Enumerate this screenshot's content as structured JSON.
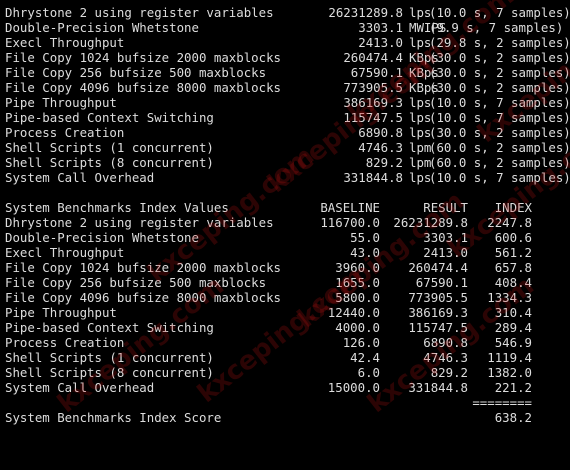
{
  "results": [
    {
      "name": "Dhrystone 2 using register variables",
      "value": "26231289.8",
      "unit": "lps",
      "note": "(10.0 s, 7 samples)"
    },
    {
      "name": "Double-Precision Whetstone",
      "value": "3303.1",
      "unit": "MWIPS",
      "note": "(9.9 s, 7 samples)"
    },
    {
      "name": "Execl Throughput",
      "value": "2413.0",
      "unit": "lps",
      "note": "(29.8 s, 2 samples)"
    },
    {
      "name": "File Copy 1024 bufsize 2000 maxblocks",
      "value": "260474.4",
      "unit": "KBps",
      "note": "(30.0 s, 2 samples)"
    },
    {
      "name": "File Copy 256 bufsize 500 maxblocks",
      "value": "67590.1",
      "unit": "KBps",
      "note": "(30.0 s, 2 samples)"
    },
    {
      "name": "File Copy 4096 bufsize 8000 maxblocks",
      "value": "773905.5",
      "unit": "KBps",
      "note": "(30.0 s, 2 samples)"
    },
    {
      "name": "Pipe Throughput",
      "value": "386169.3",
      "unit": "lps",
      "note": "(10.0 s, 7 samples)"
    },
    {
      "name": "Pipe-based Context Switching",
      "value": "115747.5",
      "unit": "lps",
      "note": "(10.0 s, 7 samples)"
    },
    {
      "name": "Process Creation",
      "value": "6890.8",
      "unit": "lps",
      "note": "(30.0 s, 2 samples)"
    },
    {
      "name": "Shell Scripts (1 concurrent)",
      "value": "4746.3",
      "unit": "lpm",
      "note": "(60.0 s, 2 samples)"
    },
    {
      "name": "Shell Scripts (8 concurrent)",
      "value": "829.2",
      "unit": "lpm",
      "note": "(60.0 s, 2 samples)"
    },
    {
      "name": "System Call Overhead",
      "value": "331844.8",
      "unit": "lps",
      "note": "(10.0 s, 7 samples)"
    }
  ],
  "index_header": {
    "title": "System Benchmarks Index Values",
    "baseline": "BASELINE",
    "result": "RESULT",
    "index": "INDEX"
  },
  "index_rows": [
    {
      "name": "Dhrystone 2 using register variables",
      "baseline": "116700.0",
      "result": "26231289.8",
      "index": "2247.8"
    },
    {
      "name": "Double-Precision Whetstone",
      "baseline": "55.0",
      "result": "3303.1",
      "index": "600.6"
    },
    {
      "name": "Execl Throughput",
      "baseline": "43.0",
      "result": "2413.0",
      "index": "561.2"
    },
    {
      "name": "File Copy 1024 bufsize 2000 maxblocks",
      "baseline": "3960.0",
      "result": "260474.4",
      "index": "657.8"
    },
    {
      "name": "File Copy 256 bufsize 500 maxblocks",
      "baseline": "1655.0",
      "result": "67590.1",
      "index": "408.4"
    },
    {
      "name": "File Copy 4096 bufsize 8000 maxblocks",
      "baseline": "5800.0",
      "result": "773905.5",
      "index": "1334.3"
    },
    {
      "name": "Pipe Throughput",
      "baseline": "12440.0",
      "result": "386169.3",
      "index": "310.4"
    },
    {
      "name": "Pipe-based Context Switching",
      "baseline": "4000.0",
      "result": "115747.5",
      "index": "289.4"
    },
    {
      "name": "Process Creation",
      "baseline": "126.0",
      "result": "6890.8",
      "index": "546.9"
    },
    {
      "name": "Shell Scripts (1 concurrent)",
      "baseline": "42.4",
      "result": "4746.3",
      "index": "1119.4"
    },
    {
      "name": "Shell Scripts (8 concurrent)",
      "baseline": "6.0",
      "result": "829.2",
      "index": "1382.0"
    },
    {
      "name": "System Call Overhead",
      "baseline": "15000.0",
      "result": "331844.8",
      "index": "221.2"
    }
  ],
  "separator": "========",
  "score": {
    "label": "System Benchmarks Index Score",
    "value": "638.2"
  },
  "watermark": "kxceping.com"
}
